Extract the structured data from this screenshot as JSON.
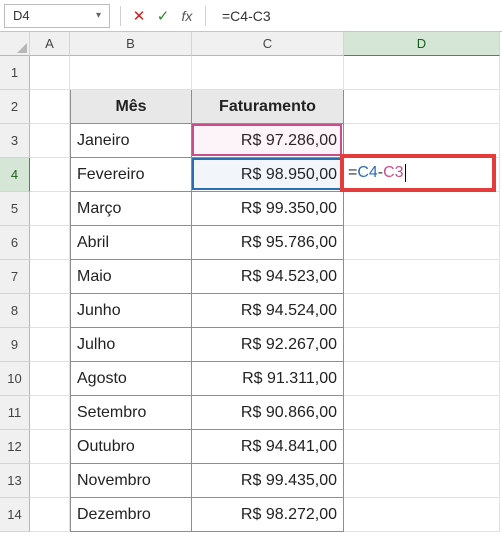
{
  "name_box": "D4",
  "formula_bar": "=C4-C3",
  "columns": [
    "A",
    "B",
    "C",
    "D"
  ],
  "selected_col_idx": 3,
  "selected_row": 4,
  "row_count": 14,
  "headers": {
    "col_b": "Mês",
    "col_c": "Faturamento"
  },
  "data_rows": [
    {
      "mes": "Janeiro",
      "fat": "R$  97.286,00"
    },
    {
      "mes": "Fevereiro",
      "fat": "R$  98.950,00"
    },
    {
      "mes": "Março",
      "fat": "R$  99.350,00"
    },
    {
      "mes": "Abril",
      "fat": "R$  95.786,00"
    },
    {
      "mes": "Maio",
      "fat": "R$  94.523,00"
    },
    {
      "mes": "Junho",
      "fat": "R$  94.524,00"
    },
    {
      "mes": "Julho",
      "fat": "R$  92.267,00"
    },
    {
      "mes": "Agosto",
      "fat": "R$  91.311,00"
    },
    {
      "mes": "Setembro",
      "fat": "R$  90.866,00"
    },
    {
      "mes": "Outubro",
      "fat": "R$  94.841,00"
    },
    {
      "mes": "Novembro",
      "fat": "R$  99.435,00"
    },
    {
      "mes": "Dezembro",
      "fat": "R$  98.272,00"
    }
  ],
  "editing_cell": {
    "tokens": [
      "=",
      "C4",
      "-",
      "C3"
    ]
  },
  "ref_colors": {
    "c3": "#c94f8b",
    "c4": "#2b6fb3"
  }
}
